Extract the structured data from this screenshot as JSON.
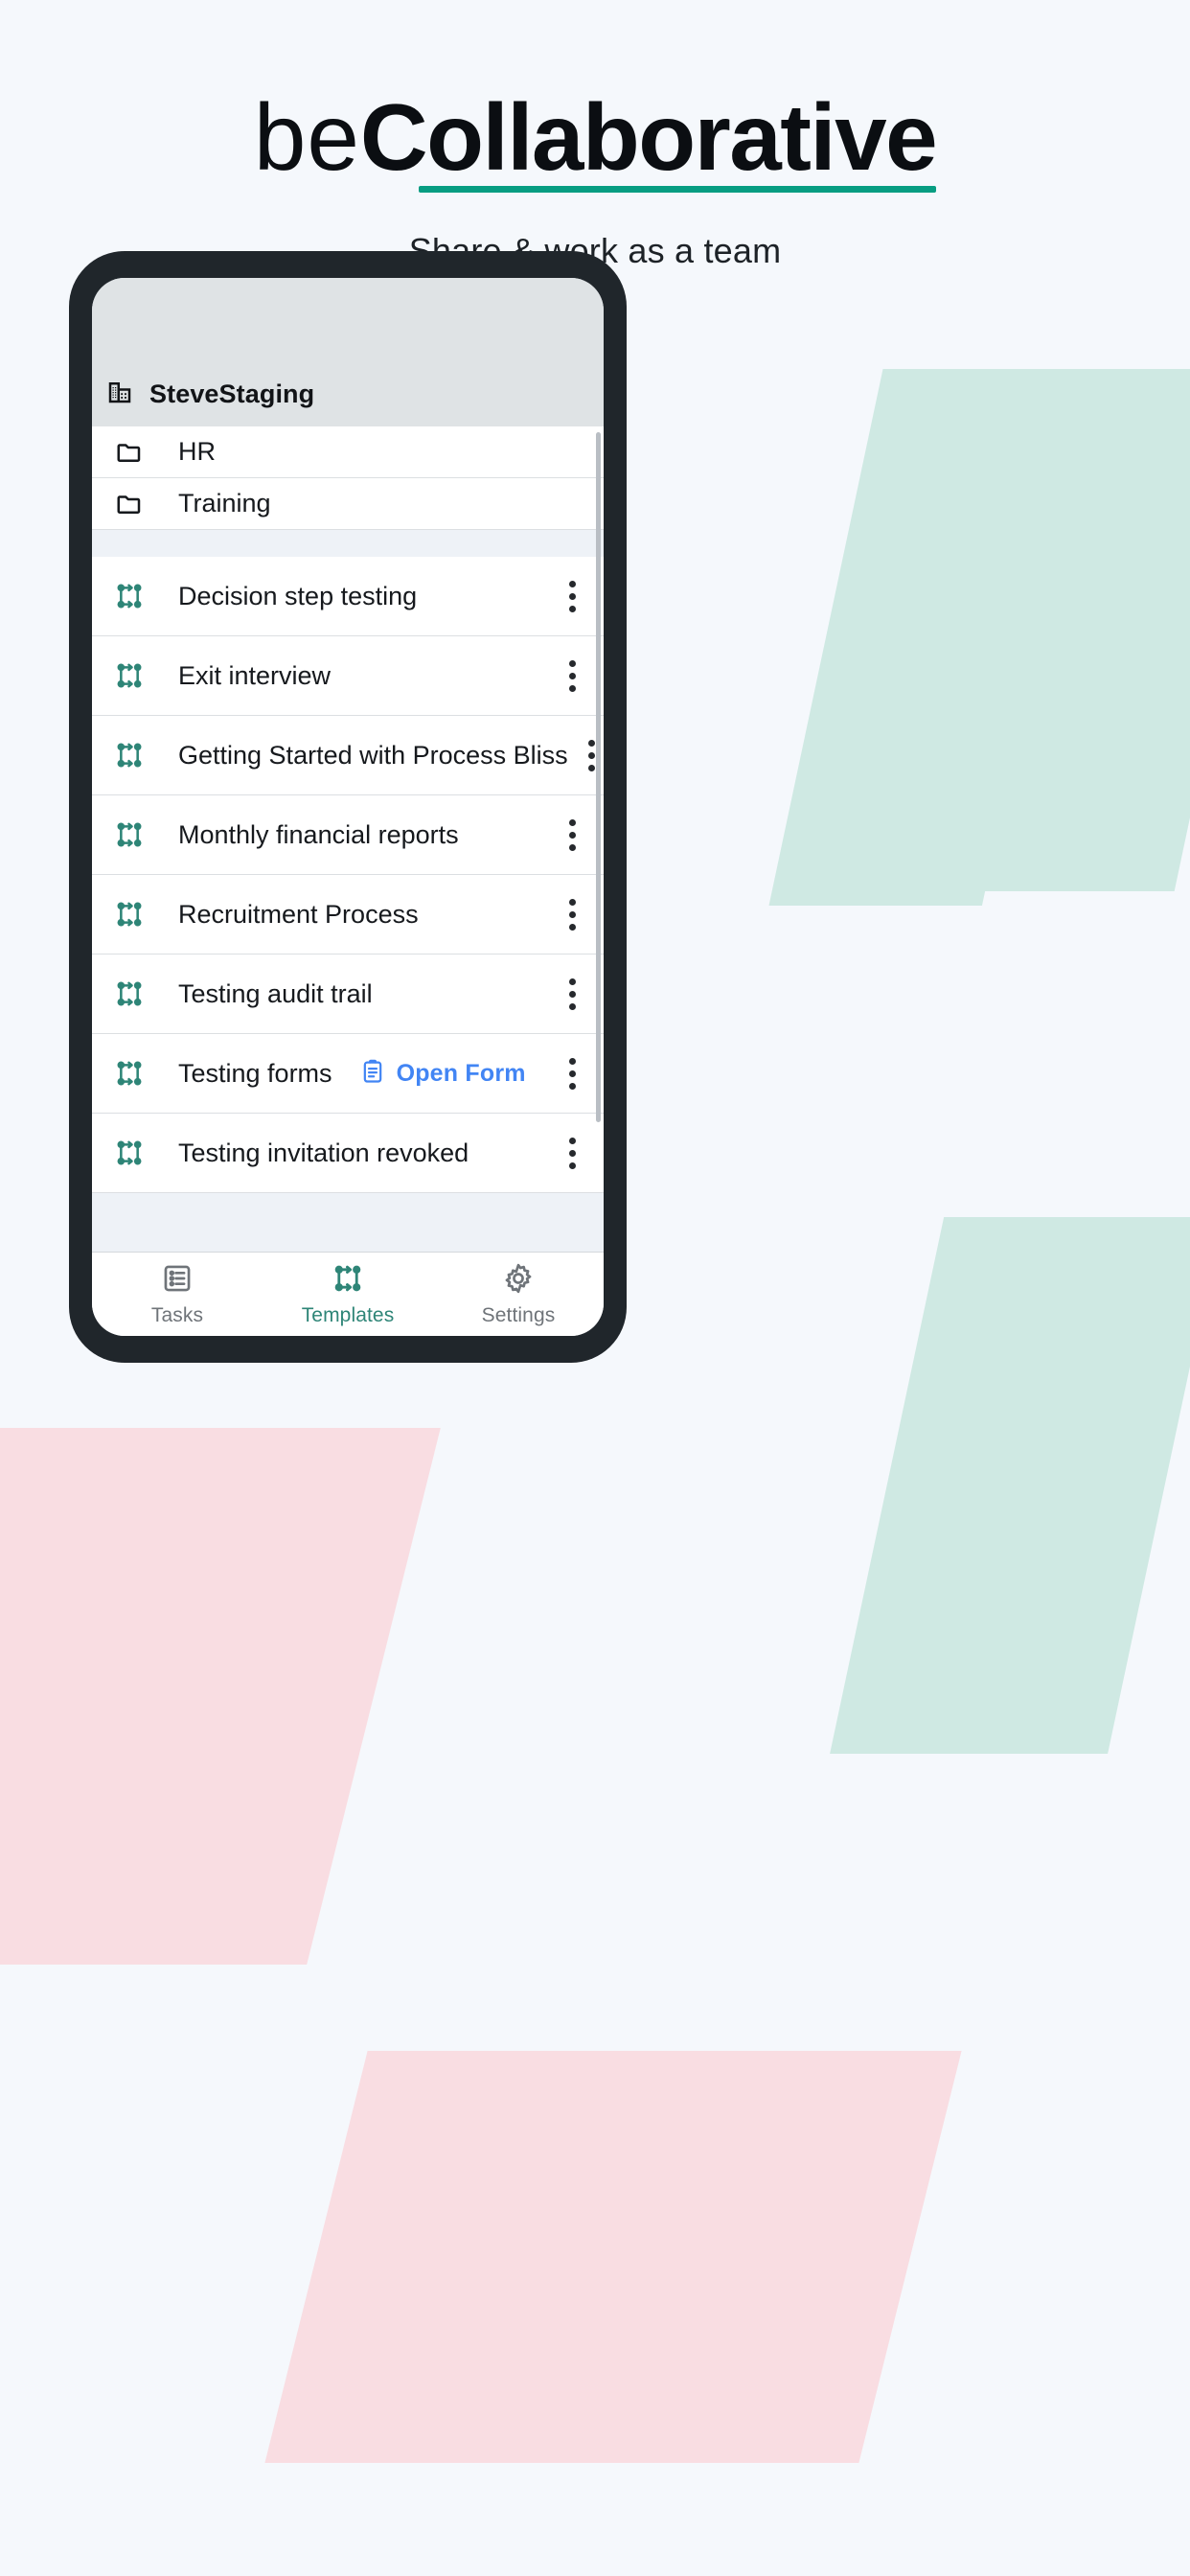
{
  "hero": {
    "logo_light": "be",
    "logo_bold": "Collaborative",
    "tagline": "Share & work as a team",
    "underline_color": "#079d82"
  },
  "phone": {
    "appbar": {
      "org_icon": "office-building-icon",
      "org_name": "SteveStaging"
    },
    "folders": [
      {
        "icon": "folder-icon",
        "label": "HR"
      },
      {
        "icon": "folder-icon",
        "label": "Training"
      }
    ],
    "templates": [
      {
        "icon": "process-flow-icon",
        "label": "Decision step testing",
        "menu_icon": "kebab-menu-icon",
        "open_form": null
      },
      {
        "icon": "process-flow-icon",
        "label": "Exit interview",
        "menu_icon": "kebab-menu-icon",
        "open_form": null
      },
      {
        "icon": "process-flow-icon",
        "label": "Getting Started with Process Bliss",
        "menu_icon": "kebab-menu-icon",
        "open_form": null
      },
      {
        "icon": "process-flow-icon",
        "label": "Monthly financial reports",
        "menu_icon": "kebab-menu-icon",
        "open_form": null
      },
      {
        "icon": "process-flow-icon",
        "label": "Recruitment Process",
        "menu_icon": "kebab-menu-icon",
        "open_form": null
      },
      {
        "icon": "process-flow-icon",
        "label": "Testing audit trail",
        "menu_icon": "kebab-menu-icon",
        "open_form": null
      },
      {
        "icon": "process-flow-icon",
        "label": "Testing forms",
        "menu_icon": "kebab-menu-icon",
        "open_form": {
          "icon": "clipboard-icon",
          "label": "Open Form",
          "color": "#4285f4"
        }
      },
      {
        "icon": "process-flow-icon",
        "label": "Testing invitation revoked",
        "menu_icon": "kebab-menu-icon",
        "open_form": null
      }
    ],
    "bottom_nav": [
      {
        "icon": "list-tasks-icon",
        "label": "Tasks",
        "active": false
      },
      {
        "icon": "process-flow-icon",
        "label": "Templates",
        "active": true
      },
      {
        "icon": "gear-icon",
        "label": "Settings",
        "active": false
      }
    ]
  },
  "colors": {
    "teal": "#2e8577",
    "brand_underline": "#079d82",
    "blue_link": "#4285f4",
    "page_bg": "#f5f8fc",
    "mint_shape": "#cfe9e3",
    "pink_shape": "#f9dde2",
    "phone_frame": "#20262b"
  }
}
